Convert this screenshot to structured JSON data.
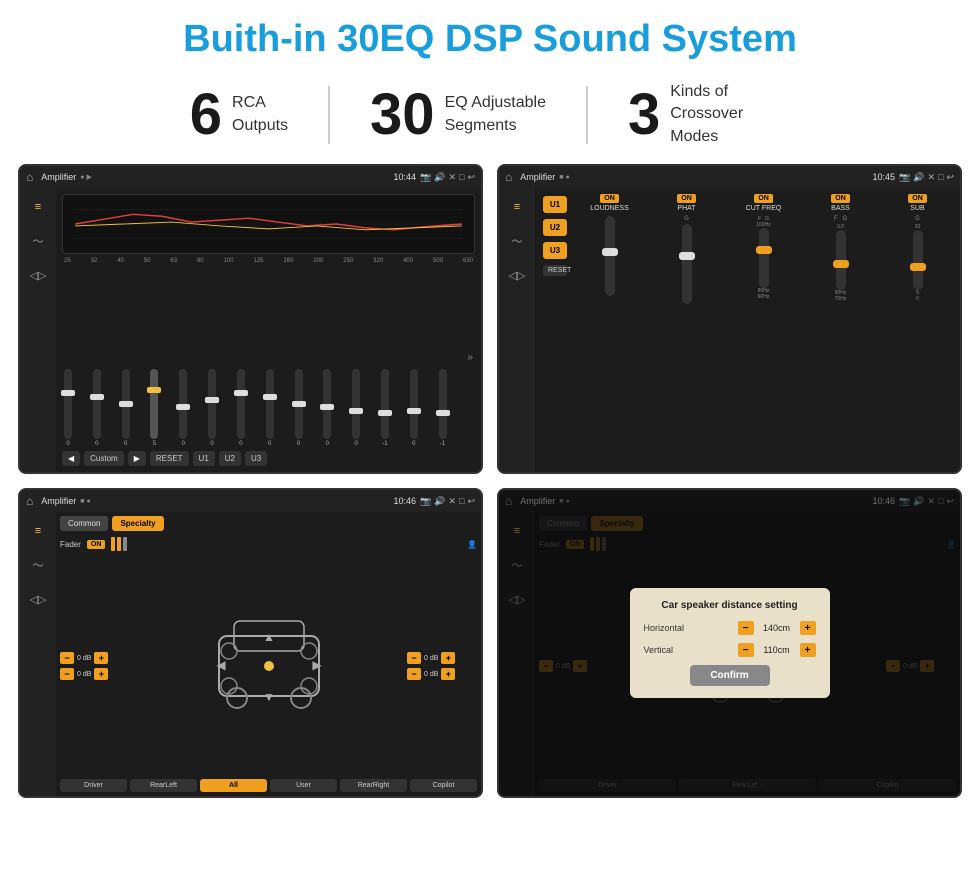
{
  "page": {
    "title": "Buith-in 30EQ DSP Sound System",
    "stats": [
      {
        "number": "6",
        "label_line1": "RCA",
        "label_line2": "Outputs"
      },
      {
        "number": "30",
        "label_line1": "EQ Adjustable",
        "label_line2": "Segments"
      },
      {
        "number": "3",
        "label_line1": "Kinds of",
        "label_line2": "Crossover Modes"
      }
    ]
  },
  "screen1": {
    "app": "Amplifier",
    "time": "10:44",
    "eq_freqs": [
      "25",
      "32",
      "40",
      "50",
      "63",
      "80",
      "100",
      "125",
      "160",
      "200",
      "250",
      "320",
      "400",
      "500",
      "630"
    ],
    "eq_values": [
      "0",
      "0",
      "0",
      "5",
      "0",
      "0",
      "0",
      "0",
      "0",
      "0",
      "0",
      "-1",
      "0",
      "-1"
    ],
    "buttons": [
      "◀",
      "Custom",
      "▶",
      "RESET",
      "U1",
      "U2",
      "U3"
    ]
  },
  "screen2": {
    "app": "Amplifier",
    "time": "10:45",
    "u_buttons": [
      "U1",
      "U2",
      "U3"
    ],
    "controls": [
      {
        "label": "LOUDNESS",
        "on": true
      },
      {
        "label": "PHAT",
        "on": true
      },
      {
        "label": "CUT FREQ",
        "on": true
      },
      {
        "label": "BASS",
        "on": true
      },
      {
        "label": "SUB",
        "on": true
      }
    ],
    "reset": "RESET"
  },
  "screen3": {
    "app": "Amplifier",
    "time": "10:46",
    "tabs": [
      "Common",
      "Specialty"
    ],
    "active_tab": "Specialty",
    "fader_label": "Fader",
    "fader_on": "ON",
    "vol_rows": [
      {
        "value": "0 dB"
      },
      {
        "value": "0 dB"
      },
      {
        "value": "0 dB"
      },
      {
        "value": "0 dB"
      }
    ],
    "bottom_buttons": [
      "Driver",
      "RearLeft",
      "All",
      "User",
      "RearRight",
      "Copilot"
    ]
  },
  "screen4": {
    "app": "Amplifier",
    "time": "10:46",
    "tabs": [
      "Common",
      "Specialty"
    ],
    "dialog": {
      "title": "Car speaker distance setting",
      "horizontal_label": "Horizontal",
      "horizontal_value": "140cm",
      "vertical_label": "Vertical",
      "vertical_value": "110cm",
      "confirm_label": "Confirm"
    },
    "vol_rows": [
      {
        "value": "0 dB"
      },
      {
        "value": "0 dB"
      }
    ],
    "bottom_buttons": [
      "Driver",
      "RearLef...",
      "Copilot"
    ]
  }
}
